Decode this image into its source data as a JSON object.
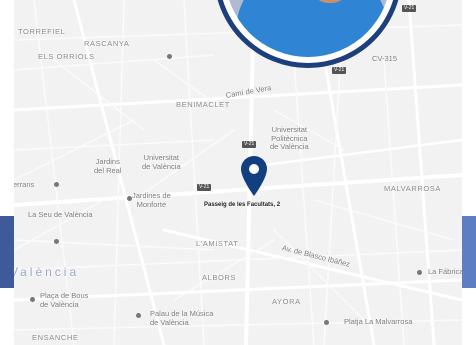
{
  "map": {
    "address": "Passeig de les Facultats, 2",
    "districts": {
      "torrefiel": "TORREFIEL",
      "rascanya": "RASCANYA",
      "els_orriols": "ELS ORRIOLS",
      "benimaclet": "BENIMACLET",
      "malvarrosa": "MALVARROSA",
      "lamistat": "L'AMISTAT",
      "albors": "ALBORS",
      "ayora": "AYORA",
      "ensanche": "ENSANCHE"
    },
    "places": {
      "universitat_politecnica": "Universitat\nPolitècnica\nde València",
      "universitat_valencia": "Universitat\nde València",
      "jardins_viveros": "Jardins\ndel Real",
      "jardines_monforte": "Jardines de\nMonforte",
      "seu_valencia": "La Seu de València",
      "valencia": "València",
      "placa_bous": "Plaça de Bous\nde València",
      "palau_musica": "Palau de la Música\nde València",
      "la_fabrica": "La Fábrica",
      "platja_malvarrosa": "Platja La Malvarrosa",
      "serrans": "Serrans",
      "camino_vera": "Camí de Vera",
      "av_blasco": "Av. de Blasco Ibáñez"
    },
    "roads": {
      "v21_a": "V-21",
      "v21_b": "V-21",
      "cv21_a": "V-21",
      "v21_c": "V-21",
      "cv31": "CV-315",
      "v21_d": "V-21"
    }
  }
}
